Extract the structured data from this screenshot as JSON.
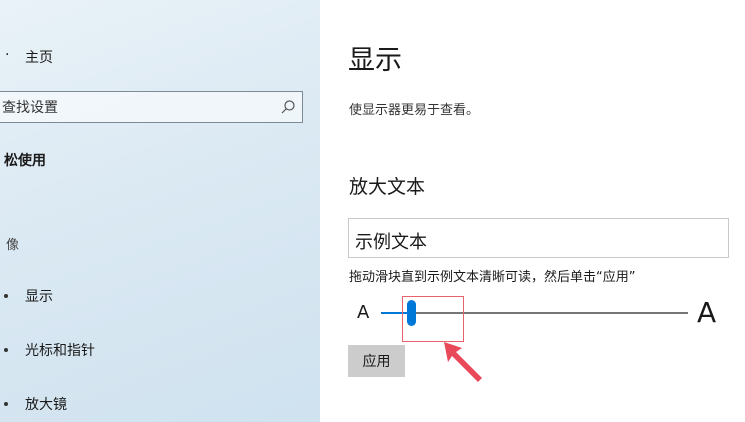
{
  "sidebar": {
    "home_label": "主页",
    "search": {
      "value": "查找设置",
      "placeholder": "查找设置"
    },
    "section_title": "松使用",
    "group_label": "像",
    "items": [
      {
        "label": "显示"
      },
      {
        "label": "光标和指针"
      },
      {
        "label": "放大镜"
      }
    ]
  },
  "main": {
    "title": "显示",
    "description": "使显示器更易于查看。",
    "text_section": {
      "heading": "放大文本",
      "sample_text": "示例文本",
      "instruction": "拖动滑块直到示例文本清晰可读，然后单击“应用”",
      "small_a": "A",
      "large_a": "A",
      "slider_value_fraction": 0.1,
      "apply_label": "应用"
    }
  },
  "colors": {
    "accent": "#0078d7",
    "highlight": "#e8616d",
    "arrow": "#e84a5a"
  },
  "icons": {
    "search": "search-icon"
  }
}
